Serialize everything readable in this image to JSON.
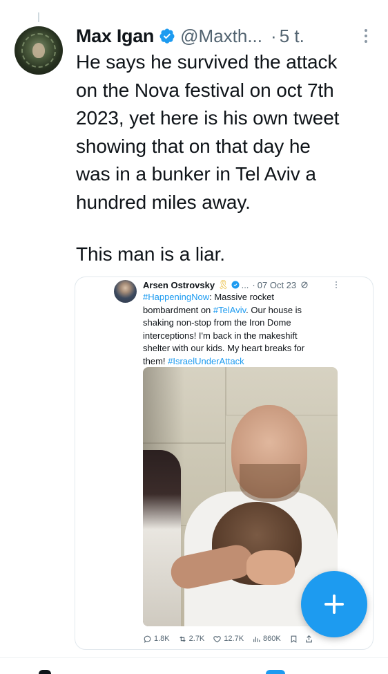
{
  "tweet": {
    "author_name": "Max Igan",
    "handle": "@Maxth...",
    "separator": "·",
    "time": "5 t.",
    "text_lines": [
      "He says he survived the attack",
      "on the Nova festival on oct 7th",
      "2023, yet here is his own tweet",
      "showing that on that day he",
      "was in a bunker in Tel Aviv a",
      "hundred miles away."
    ],
    "text_final": "This man is a liar."
  },
  "quoted": {
    "author_name": "Arsen Ostrovsky",
    "ribbon_icon": "ribbon-emoji",
    "handle": "...",
    "separator": "·",
    "date": "07 Oct 23",
    "body": {
      "hashtag1": "#HappeningNow",
      "text1": ": Massive rocket bombardment on ",
      "hashtag2": "#TelAviv",
      "text2": ". Our house is shaking non-stop from the Iron Dome interceptions! I'm back in the makeshift shelter with our kids. My heart breaks for them! ",
      "hashtag3": "#IsraelUnderAttack"
    },
    "stats": {
      "replies": "1.8K",
      "reposts": "2.7K",
      "likes": "12.7K",
      "views": "860K"
    }
  },
  "colors": {
    "accent": "#1d9bf0",
    "text": "#0f1419",
    "muted": "#536471"
  }
}
